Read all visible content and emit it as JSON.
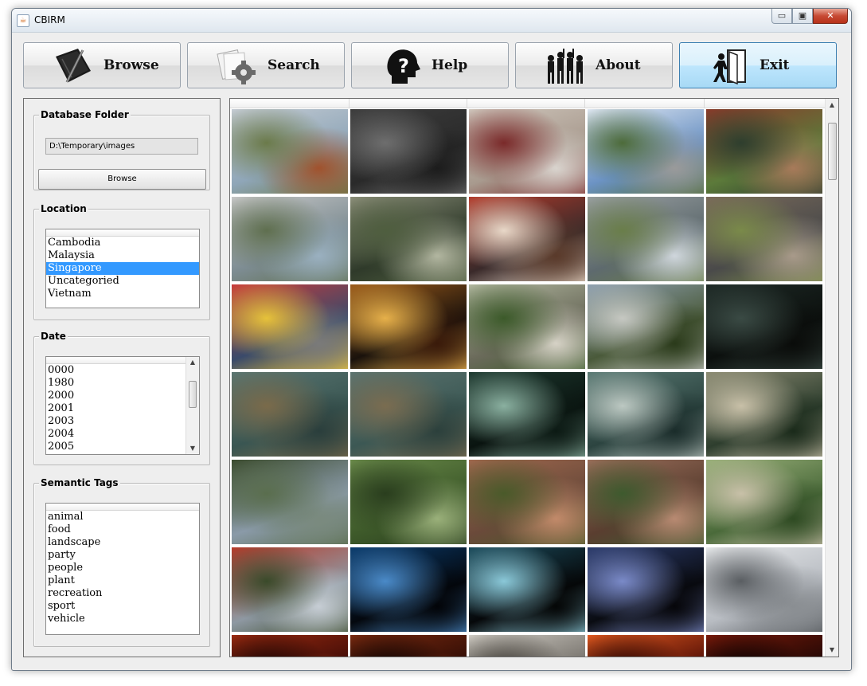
{
  "window": {
    "title": "CBIRM",
    "app_icon_glyph": "☕",
    "controls": {
      "minimize": "▭",
      "maximize": "▣",
      "close": "✕"
    }
  },
  "toolbar": {
    "buttons": [
      {
        "label": "Browse",
        "icon": "notebook-pen-icon"
      },
      {
        "label": "Search",
        "icon": "documents-gear-icon"
      },
      {
        "label": "Help",
        "icon": "head-question-icon"
      },
      {
        "label": "About",
        "icon": "people-silhouette-icon"
      },
      {
        "label": "Exit",
        "icon": "door-exit-icon",
        "state": "hover"
      }
    ]
  },
  "sidebar": {
    "database": {
      "title": "Database Folder",
      "path": "D:\\Temporary\\images",
      "browse_label": "Browse"
    },
    "location": {
      "title": "Location",
      "items": [
        "Cambodia",
        "Malaysia",
        "Singapore",
        "Uncategoried",
        "Vietnam"
      ],
      "selected": "Singapore"
    },
    "date": {
      "title": "Date",
      "items": [
        "0000",
        "1980",
        "2000",
        "2001",
        "2003",
        "2004",
        "2005"
      ]
    },
    "tags": {
      "title": "Semantic Tags",
      "items": [
        "animal",
        "food",
        "landscape",
        "party",
        "people",
        "plant",
        "recreation",
        "sport",
        "vehicle"
      ]
    }
  },
  "gallery": {
    "columns": 5,
    "image_count": 35,
    "selection_color": "#3399ff"
  }
}
